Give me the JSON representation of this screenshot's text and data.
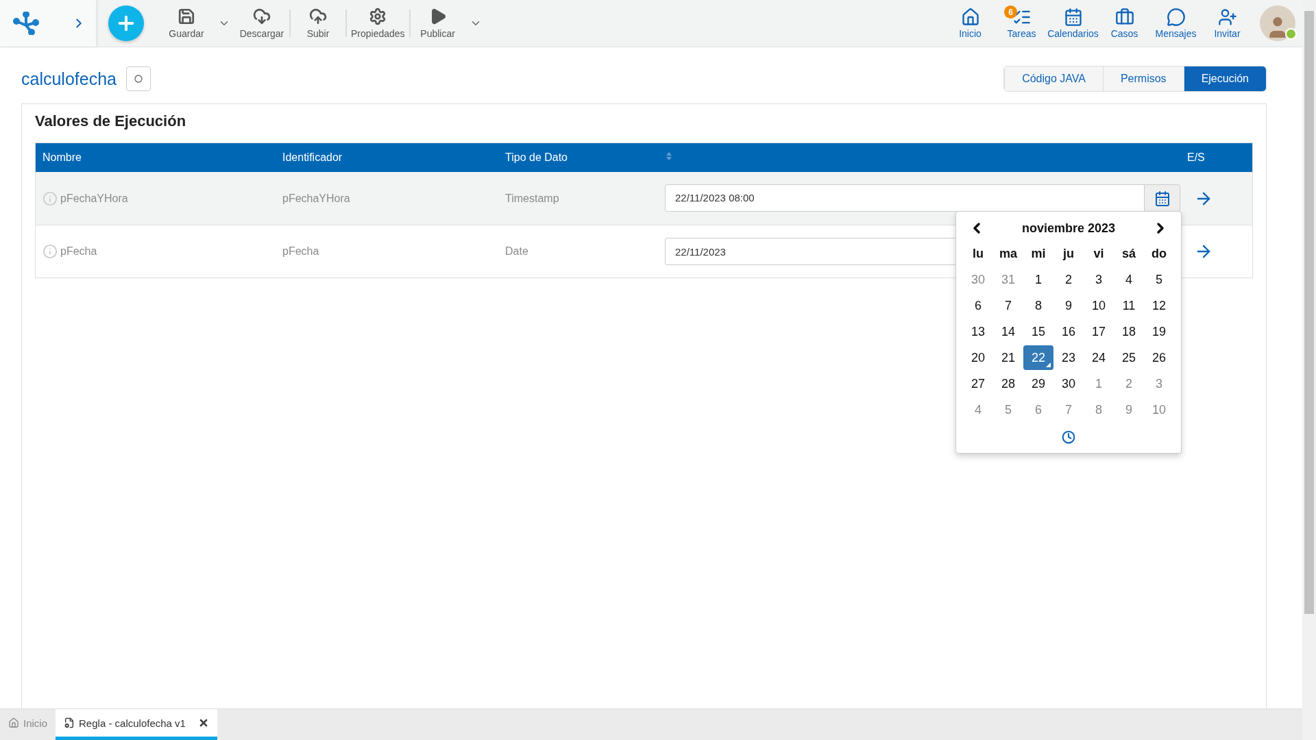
{
  "toolbar": {
    "items": [
      {
        "label": "Guardar",
        "has_menu": true
      },
      {
        "label": "Descargar",
        "has_menu": false
      },
      {
        "label": "Subir",
        "has_menu": false
      },
      {
        "label": "Propiedades",
        "has_menu": false
      },
      {
        "label": "Publicar",
        "has_menu": true
      }
    ],
    "nav": [
      {
        "label": "Inicio"
      },
      {
        "label": "Tareas",
        "badge": "6"
      },
      {
        "label": "Calendarios"
      },
      {
        "label": "Casos"
      },
      {
        "label": "Mensajes"
      },
      {
        "label": "Invitar"
      }
    ],
    "user": {
      "online": true
    }
  },
  "page": {
    "title": "calculofecha",
    "view_tabs": [
      {
        "label": "Código JAVA",
        "selected": false
      },
      {
        "label": "Permisos",
        "selected": false
      },
      {
        "label": "Ejecución",
        "selected": true
      }
    ]
  },
  "section": {
    "title": "Valores de Ejecución",
    "table": {
      "columns": [
        "Nombre",
        "Identificador",
        "Tipo de Dato"
      ],
      "last_column": "E/S",
      "rows": [
        {
          "name": "pFechaYHora",
          "identifier": "pFechaYHora",
          "type": "Timestamp",
          "value": "22/11/2023 08:00",
          "highlighted": true,
          "picker_open": true
        },
        {
          "name": "pFecha",
          "identifier": "pFecha",
          "type": "Date",
          "value": "22/11/2023",
          "highlighted": false,
          "picker_open": false
        }
      ]
    }
  },
  "datepicker": {
    "month": "noviembre 2023",
    "weekdays": [
      "lu",
      "ma",
      "mi",
      "ju",
      "vi",
      "sá",
      "do"
    ],
    "days": [
      {
        "label": "30",
        "other_month": true,
        "selected": false
      },
      {
        "label": "31",
        "other_month": true,
        "selected": false
      },
      {
        "label": "1",
        "other_month": false,
        "selected": false
      },
      {
        "label": "2",
        "other_month": false,
        "selected": false
      },
      {
        "label": "3",
        "other_month": false,
        "selected": false
      },
      {
        "label": "4",
        "other_month": false,
        "selected": false
      },
      {
        "label": "5",
        "other_month": false,
        "selected": false
      },
      {
        "label": "6",
        "other_month": false,
        "selected": false
      },
      {
        "label": "7",
        "other_month": false,
        "selected": false
      },
      {
        "label": "8",
        "other_month": false,
        "selected": false
      },
      {
        "label": "9",
        "other_month": false,
        "selected": false
      },
      {
        "label": "10",
        "other_month": false,
        "selected": false
      },
      {
        "label": "11",
        "other_month": false,
        "selected": false
      },
      {
        "label": "12",
        "other_month": false,
        "selected": false
      },
      {
        "label": "13",
        "other_month": false,
        "selected": false
      },
      {
        "label": "14",
        "other_month": false,
        "selected": false
      },
      {
        "label": "15",
        "other_month": false,
        "selected": false
      },
      {
        "label": "16",
        "other_month": false,
        "selected": false
      },
      {
        "label": "17",
        "other_month": false,
        "selected": false
      },
      {
        "label": "18",
        "other_month": false,
        "selected": false
      },
      {
        "label": "19",
        "other_month": false,
        "selected": false
      },
      {
        "label": "20",
        "other_month": false,
        "selected": false
      },
      {
        "label": "21",
        "other_month": false,
        "selected": false
      },
      {
        "label": "22",
        "other_month": false,
        "selected": true
      },
      {
        "label": "23",
        "other_month": false,
        "selected": false
      },
      {
        "label": "24",
        "other_month": false,
        "selected": false
      },
      {
        "label": "25",
        "other_month": false,
        "selected": false
      },
      {
        "label": "26",
        "other_month": false,
        "selected": false
      },
      {
        "label": "27",
        "other_month": false,
        "selected": false
      },
      {
        "label": "28",
        "other_month": false,
        "selected": false
      },
      {
        "label": "29",
        "other_month": false,
        "selected": false
      },
      {
        "label": "30",
        "other_month": false,
        "selected": false
      },
      {
        "label": "1",
        "other_month": true,
        "selected": false
      },
      {
        "label": "2",
        "other_month": true,
        "selected": false
      },
      {
        "label": "3",
        "other_month": true,
        "selected": false
      },
      {
        "label": "4",
        "other_month": true,
        "selected": false
      },
      {
        "label": "5",
        "other_month": true,
        "selected": false
      },
      {
        "label": "6",
        "other_month": true,
        "selected": false
      },
      {
        "label": "7",
        "other_month": true,
        "selected": false
      },
      {
        "label": "8",
        "other_month": true,
        "selected": false
      },
      {
        "label": "9",
        "other_month": true,
        "selected": false
      },
      {
        "label": "10",
        "other_month": true,
        "selected": false
      }
    ]
  },
  "bottom_tabs": [
    {
      "label": "Inicio",
      "kind": "home",
      "selected": false
    },
    {
      "label": "Regla - calculofecha v1",
      "kind": "document",
      "selected": true
    }
  ]
}
